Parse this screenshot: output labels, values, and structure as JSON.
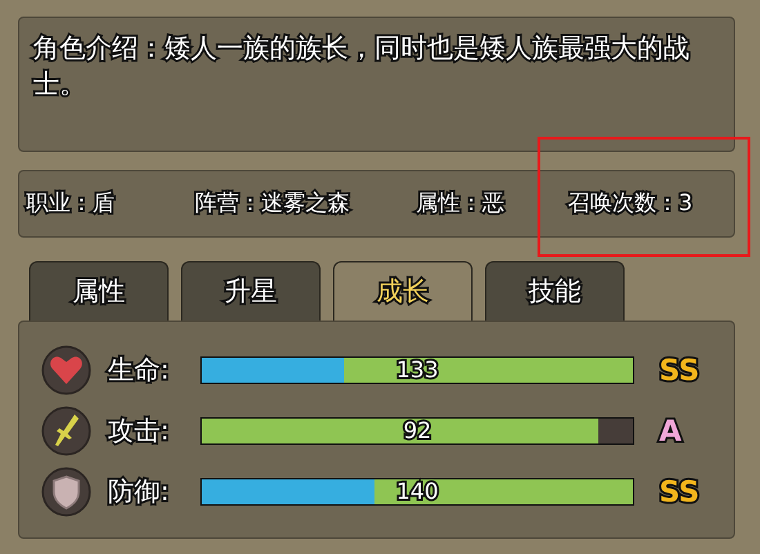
{
  "description": "角色介绍：矮人一族的族长，同时也是矮人族最强大的战士。",
  "info": [
    {
      "label": "职业：盾",
      "highlighted": false
    },
    {
      "label": "阵营：迷雾之森",
      "highlighted": false
    },
    {
      "label": "属性：恶",
      "highlighted": false
    },
    {
      "label": "召唤次数：3",
      "highlighted": true
    }
  ],
  "tabs": [
    {
      "label": "属性",
      "selected": false
    },
    {
      "label": "升星",
      "selected": false
    },
    {
      "label": "成长",
      "selected": true
    },
    {
      "label": "技能",
      "selected": false
    }
  ],
  "stats": [
    {
      "kind": "heart",
      "label": "生命:",
      "value": "133",
      "base": {
        "level": 0.33
      },
      "growth": {
        "level": 1
      },
      "grade": "SS",
      "color": "#f2b51c"
    },
    {
      "kind": "sword",
      "label": "攻击:",
      "value": "92",
      "growth": {
        "level": 0.92
      },
      "grade": "A",
      "color": "#f0a6d8"
    },
    {
      "kind": "shield",
      "label": "防御:",
      "value": "140",
      "base": {
        "level": 0.4
      },
      "growth": {
        "level": 1
      },
      "grade": "SS",
      "color": "#f2b51c"
    }
  ]
}
